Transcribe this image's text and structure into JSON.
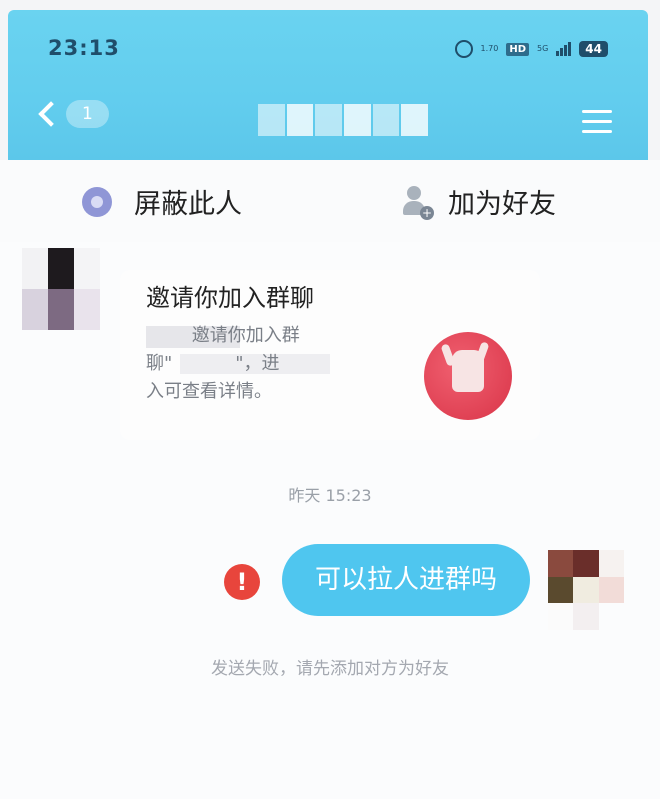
{
  "status_bar": {
    "time": "23:13",
    "net_speed": "1.70",
    "hd": "HD",
    "network": "5G",
    "battery": "44"
  },
  "nav": {
    "unread_count": "1"
  },
  "actions": {
    "block_label": "屏蔽此人",
    "add_friend_label": "加为好友"
  },
  "invite_card": {
    "title": "邀请你加入群聊",
    "description": "        邀请你加入群\n聊\"           \"，进\n入可查看详情。"
  },
  "chat": {
    "timestamp": "昨天 15:23",
    "sent_message": "可以拉人进群吗",
    "error_icon": "!",
    "error_text": "发送失败，请先添加对方为好友"
  },
  "icons": {
    "alarm": "alarm-icon",
    "signal": "signal-icon",
    "back": "chevron-left-icon",
    "menu": "menu-icon",
    "block": "block-icon",
    "add_friend": "add-friend-icon",
    "group": "hand-icon",
    "fail": "error-icon"
  },
  "colors": {
    "header": "#62cdee",
    "bubble": "#4fc6ef",
    "error": "#e8453c"
  }
}
